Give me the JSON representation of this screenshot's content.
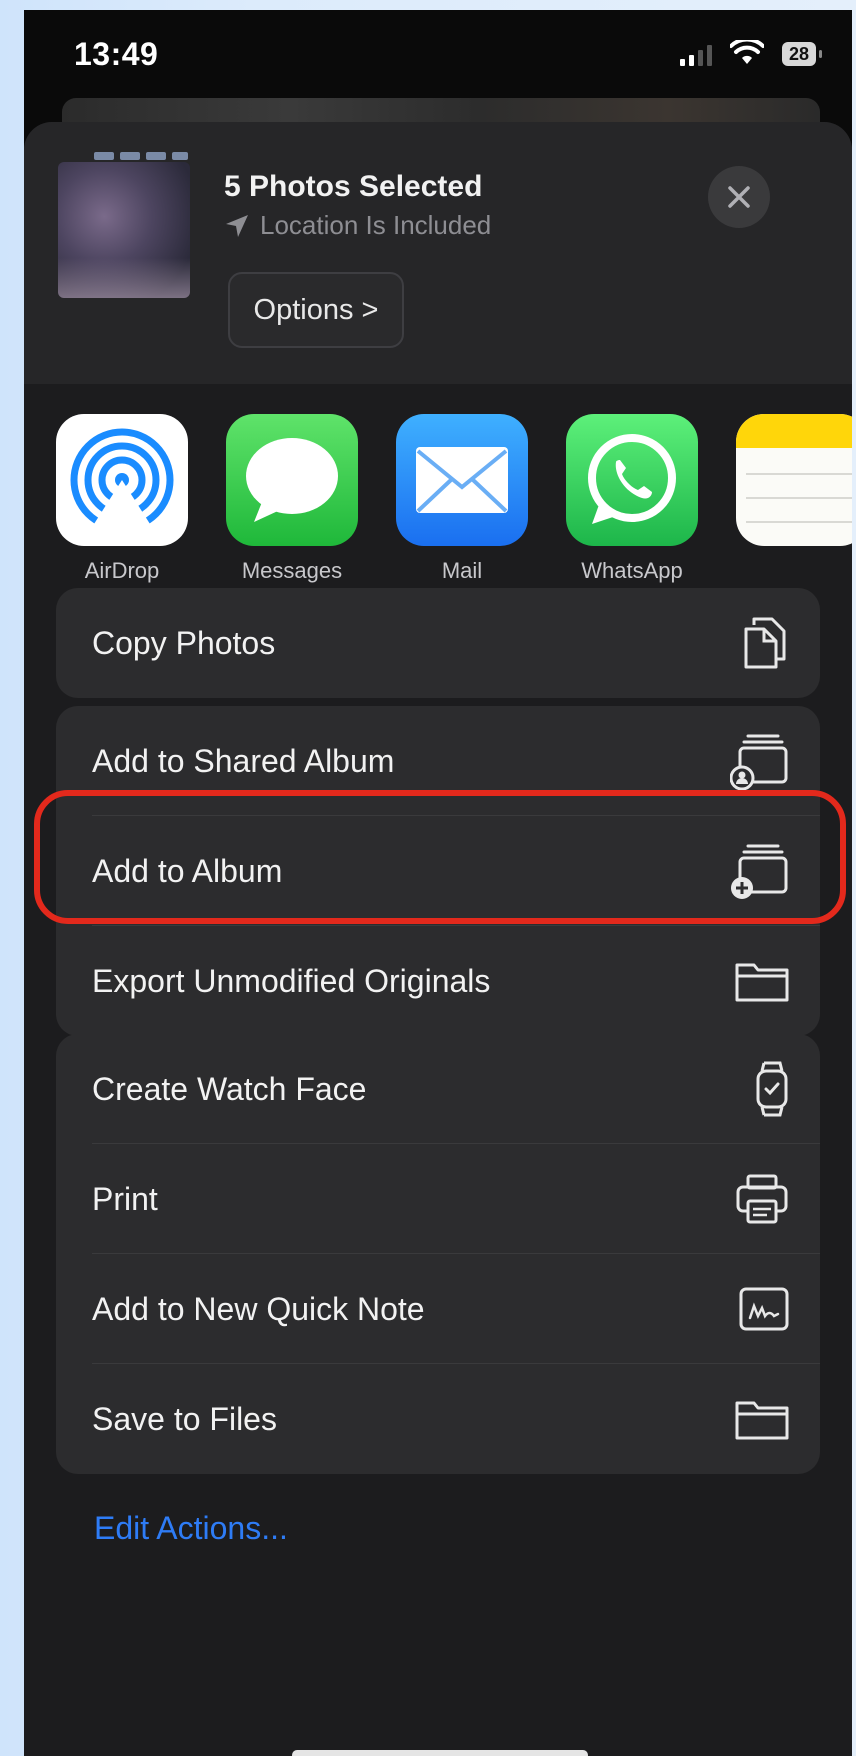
{
  "status_bar": {
    "time": "13:49",
    "battery": "28"
  },
  "share_header": {
    "title": "5 Photos Selected",
    "subtitle": "Location Is Included",
    "options_label": "Options >"
  },
  "apps": [
    {
      "label": "AirDrop",
      "icon": "airdrop-icon",
      "color": "#ffffff"
    },
    {
      "label": "Messages",
      "icon": "messages-icon",
      "color": "#34c759"
    },
    {
      "label": "Mail",
      "icon": "mail-icon",
      "color": "#1a8cff"
    },
    {
      "label": "WhatsApp",
      "icon": "whatsapp-icon",
      "color": "#25d366"
    },
    {
      "label": "",
      "icon": "notes-icon",
      "color": "#ffd60a"
    }
  ],
  "actions_group1": [
    {
      "label": "Copy Photos",
      "icon": "copy-icon"
    }
  ],
  "actions_group2": [
    {
      "label": "Add to Shared Album",
      "icon": "shared-album-icon"
    },
    {
      "label": "Add to Album",
      "icon": "add-album-icon"
    },
    {
      "label": "Export Unmodified Originals",
      "icon": "folder-icon"
    }
  ],
  "actions_group3": [
    {
      "label": "Create Watch Face",
      "icon": "watch-icon"
    },
    {
      "label": "Print",
      "icon": "printer-icon"
    },
    {
      "label": "Add to New Quick Note",
      "icon": "quick-note-icon"
    },
    {
      "label": "Save to Files",
      "icon": "folder-icon"
    }
  ],
  "edit_actions_label": "Edit Actions...",
  "colors": {
    "link": "#2e7cf6",
    "highlight": "#e3291c",
    "sheet": "#1c1c1e",
    "group": "#2c2c2e"
  }
}
